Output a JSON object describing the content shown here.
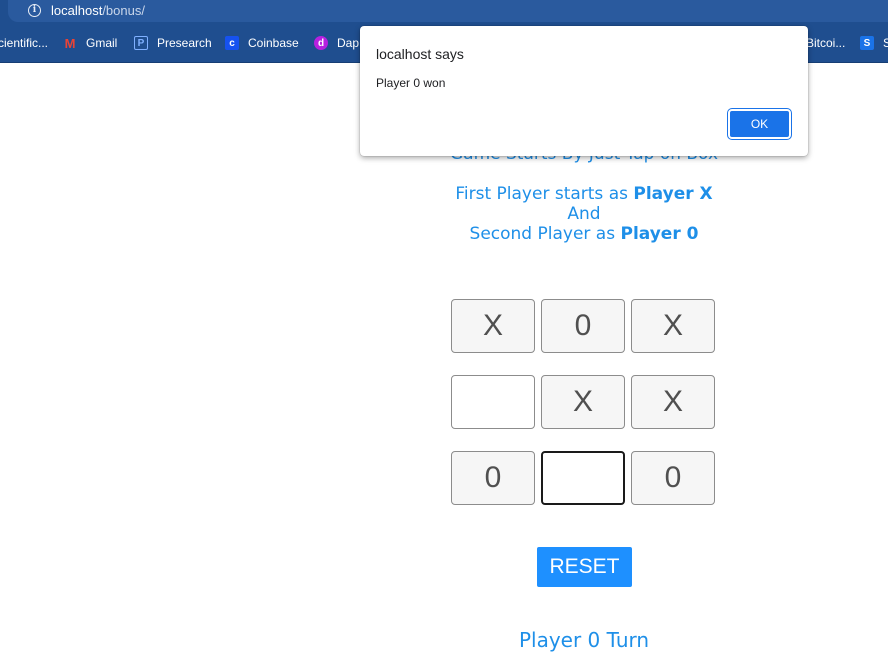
{
  "browser": {
    "url_host": "localhost",
    "url_path": "/bonus/",
    "bookmarks": [
      {
        "label": "cientific...",
        "icon": "none"
      },
      {
        "label": "Gmail",
        "icon": "gmail-icon",
        "color": "#ea4335"
      },
      {
        "label": "Presearch",
        "icon": "presearch-icon",
        "color": "#2d6bf0"
      },
      {
        "label": "Coinbase",
        "icon": "coinbase-icon",
        "color": "#1652f0"
      },
      {
        "label": "Dap",
        "icon": "dapp-icon",
        "color": "#b620e0"
      },
      {
        "label": "Bitcoi...",
        "icon": "none"
      },
      {
        "label": "S",
        "icon": "s-icon",
        "color": "#1a73e8"
      }
    ]
  },
  "dialog": {
    "title": "localhost says",
    "message": "Player 0 won",
    "ok_label": "OK"
  },
  "intro": {
    "line_partial": "Game Starts By Just Tap on Box",
    "first_prefix": "First Player starts as ",
    "first_strong": "Player X",
    "and": "And",
    "second_prefix": "Second Player as ",
    "second_strong": "Player 0"
  },
  "board": [
    [
      "X",
      "0",
      "X"
    ],
    [
      "",
      "X",
      "X"
    ],
    [
      "0",
      "",
      "0"
    ]
  ],
  "reset_label": "RESET",
  "turn_text": "Player 0 Turn",
  "colors": {
    "accent": "#1e8fe8",
    "button": "#1e90ff",
    "chrome": "#1f4e8f"
  }
}
